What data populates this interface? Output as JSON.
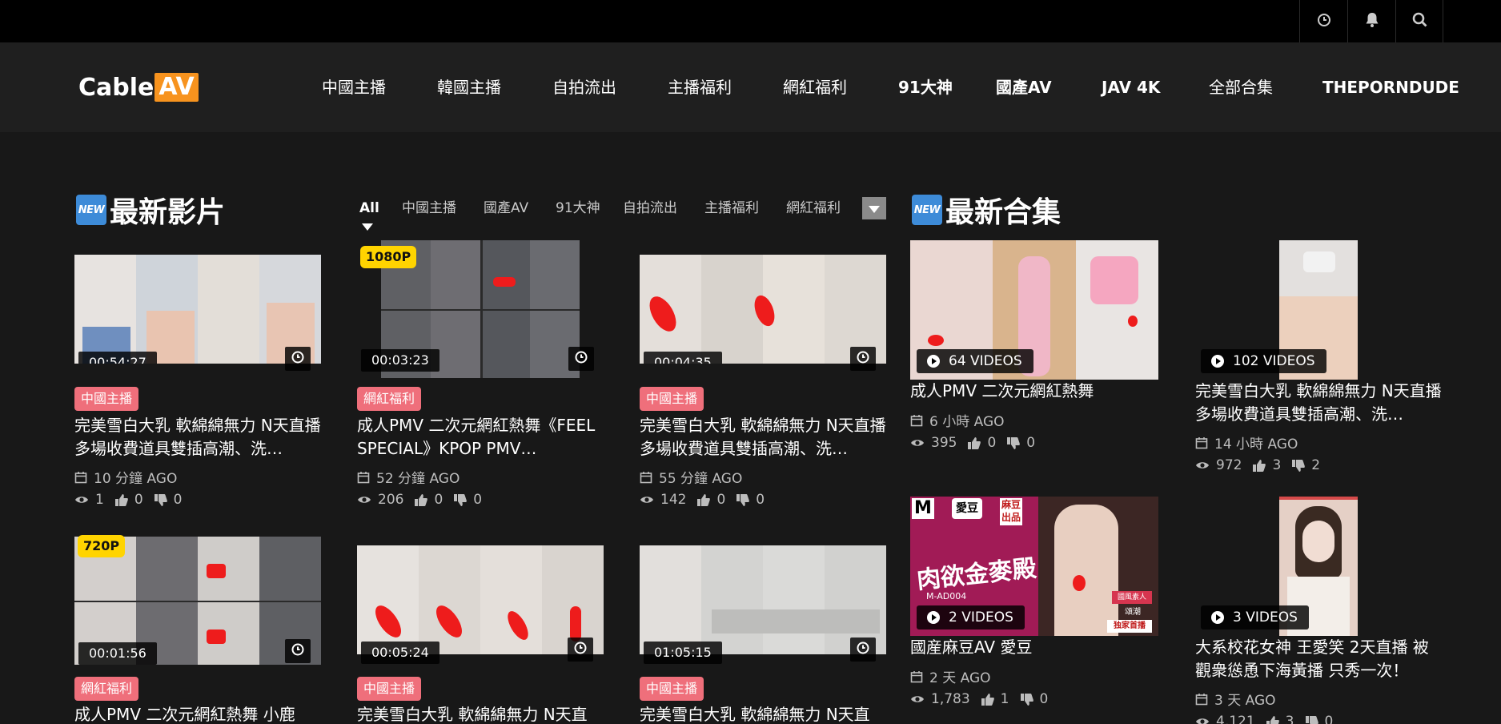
{
  "site": {
    "logo_part1": "Cable",
    "logo_part2": "AV"
  },
  "topbar": {
    "icons": [
      "history-icon",
      "bell-icon",
      "search-icon"
    ]
  },
  "nav": {
    "items": [
      "中國主播",
      "韓國主播",
      "自拍流出",
      "主播福利",
      "網紅福利",
      "91大神",
      "國產AV",
      "JAV 4K",
      "全部合集",
      "THEPORNDUDE"
    ]
  },
  "latest_videos": {
    "badge": "NEW",
    "title": "最新影片",
    "tabs": [
      "All",
      "中國主播",
      "國產AV",
      "91大神",
      "自拍流出",
      "主播福利",
      "網紅福利"
    ],
    "active_tab": "All",
    "cards": [
      {
        "duration": "00:54:27",
        "quality": "",
        "category": "中國主播",
        "title": "完美雪白大乳 軟綿綿無力 N天直播 多場收費道具雙插高潮、洗…",
        "time": "10 分鐘 AGO",
        "views": "1",
        "likes": "0",
        "dislikes": "0"
      },
      {
        "duration": "00:03:23",
        "quality": "1080P",
        "category": "網紅福利",
        "title": "成人PMV 二次元網紅熱舞《FEEL SPECIAL》KPOP PMV…",
        "time": "52 分鐘 AGO",
        "views": "206",
        "likes": "0",
        "dislikes": "0"
      },
      {
        "duration": "00:04:35",
        "quality": "",
        "category": "中國主播",
        "title": "完美雪白大乳 軟綿綿無力 N天直播 多場收費道具雙插高潮、洗…",
        "time": "55 分鐘 AGO",
        "views": "142",
        "likes": "0",
        "dislikes": "0"
      },
      {
        "duration": "00:01:56",
        "quality": "720P",
        "category": "網紅福利",
        "title": "成人PMV 二次元網紅熱舞 小鹿",
        "time": "",
        "views": "",
        "likes": "",
        "dislikes": ""
      },
      {
        "duration": "00:05:24",
        "quality": "",
        "category": "中國主播",
        "title": "完美雪白大乳 軟綿綿無力 N天直",
        "time": "",
        "views": "",
        "likes": "",
        "dislikes": ""
      },
      {
        "duration": "01:05:15",
        "quality": "",
        "category": "中國主播",
        "title": "完美雪白大乳 軟綿綿無力 N天直",
        "time": "",
        "views": "",
        "likes": "",
        "dislikes": ""
      }
    ]
  },
  "latest_collections": {
    "badge": "NEW",
    "title": "最新合集",
    "cards": [
      {
        "videos": "64 VIDEOS",
        "title": "成人PMV 二次元網紅熱舞",
        "time": "6 小時 AGO",
        "views": "395",
        "likes": "0",
        "dislikes": "0"
      },
      {
        "videos": "102 VIDEOS",
        "title": "完美雪白大乳 軟綿綿無力 N天直播 多場收費道具雙插高潮、洗…",
        "time": "14 小時 AGO",
        "views": "972",
        "likes": "3",
        "dislikes": "2"
      },
      {
        "videos": "2 VIDEOS",
        "title": "國産麻豆AV 愛豆",
        "time": "2 天 AGO",
        "views": "1,783",
        "likes": "1",
        "dislikes": "0",
        "poster_text": [
          "M",
          "愛豆",
          "麻豆",
          "出品",
          "肉欲金麥殿",
          "M-AD004",
          "國風素人",
          "頌潮",
          "独家首播"
        ]
      },
      {
        "videos": "3 VIDEOS",
        "title": "大系校花女神 王愛笑 2天直播 被觀衆慫恿下海黃播 只秀一次！",
        "time": "3 天 AGO",
        "views": "4,121",
        "likes": "3",
        "dislikes": "0"
      }
    ]
  },
  "colors": {
    "topbar": "#000000",
    "header": "#1f1f1f",
    "page": "#181818",
    "logo_accent": "#f7931e",
    "category_tag": "#ef6f7b",
    "new_badge": "#3d8bd8",
    "quality_badge": "#ffd400"
  }
}
